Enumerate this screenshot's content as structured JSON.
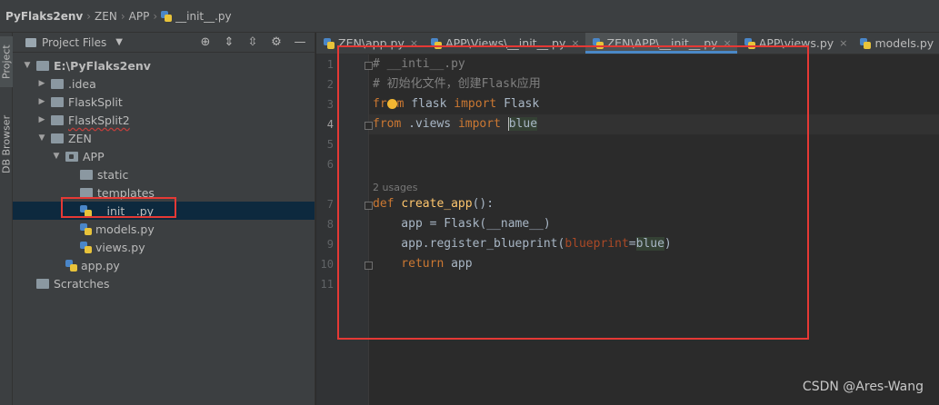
{
  "breadcrumb": {
    "project": "PyFlaks2env",
    "folder1": "ZEN",
    "folder2": "APP",
    "file": "__init__.py"
  },
  "tool_stripe": {
    "project_tab": "Project",
    "db_tab": "DB Browser"
  },
  "project_panel": {
    "title": "Project Files",
    "tree": {
      "root": "E:\\PyFlaks2env",
      "idea": ".idea",
      "flasksplit": "FlaskSplit",
      "flasksplit2": "FlaskSplit2",
      "zen": "ZEN",
      "app": "APP",
      "static": "static",
      "templates": "templates",
      "init": "__init__.py",
      "models": "models.py",
      "views": "views.py",
      "app_py": "app.py",
      "scratches": "Scratches"
    }
  },
  "tabs": [
    {
      "label": "ZEN\\app.py"
    },
    {
      "label": "APP\\Views\\__init__.py"
    },
    {
      "label": "ZEN\\APP\\__init__.py"
    },
    {
      "label": "APP\\views.py"
    },
    {
      "label": "models.py"
    }
  ],
  "editor": {
    "line_numbers": [
      "1",
      "2",
      "3",
      "4",
      "5",
      "6",
      "7",
      "8",
      "9",
      "10",
      "11"
    ],
    "current_line": "4",
    "code": {
      "l1": "# __inti__.py",
      "l2": "# 初始化文件，创建Flask应用",
      "l3_kw1": "fr",
      "l3_kw1b": "m",
      "l3_mod": " flask ",
      "l3_kw2": "import",
      "l3_name": " Flask",
      "l4_kw1": "from",
      "l4_mod": " .views ",
      "l4_kw2": "import",
      "l4_sp": " ",
      "l4_name": "blue",
      "usages": "2 usages",
      "l7_kw": "def",
      "l7_fn": "create_app",
      "l7_rest": "():",
      "l8": "    app = Flask(__name__)",
      "l9_pre": "    app.register_blueprint(",
      "l9_param": "blueprint",
      "l9_eq": "=",
      "l9_val": "blue",
      "l9_close": ")",
      "l10_kw": "    return",
      "l10_rest": " app"
    }
  },
  "watermark": "CSDN @Ares-Wang",
  "colors": {
    "accent": "#4a88c7",
    "annotation_red": "#e53935",
    "keyword": "#cc7832",
    "function": "#ffc66d",
    "comment": "#808080"
  }
}
